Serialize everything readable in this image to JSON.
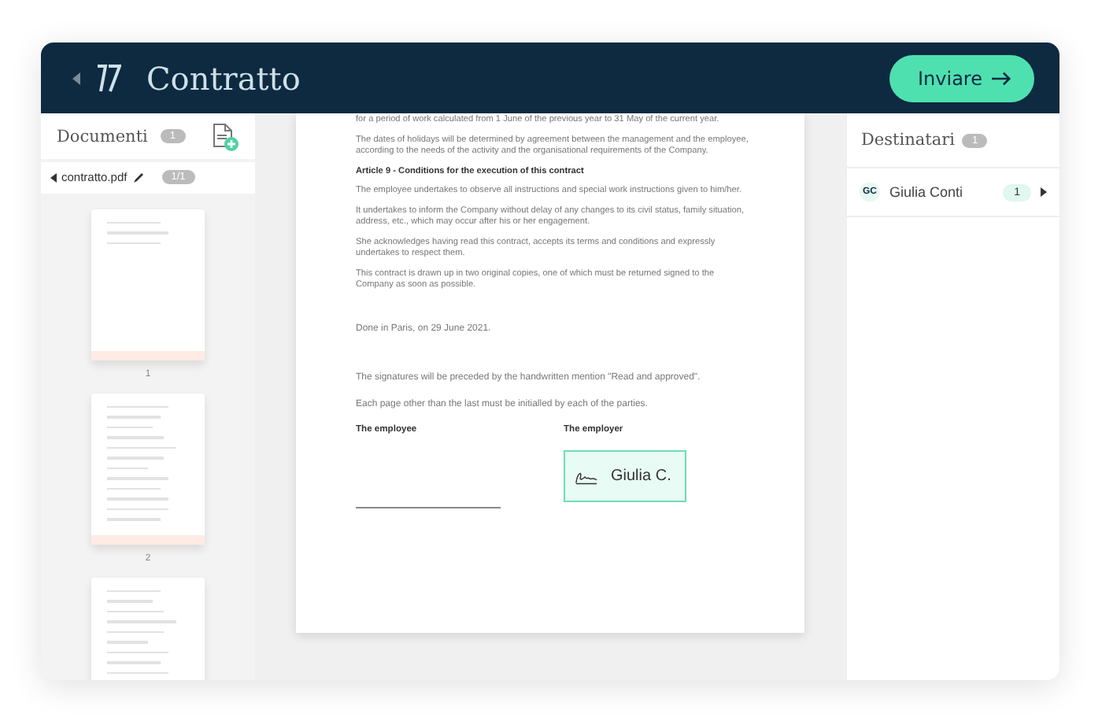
{
  "header": {
    "title": "Contratto",
    "send_button": "Inviare"
  },
  "documents": {
    "title": "Documenti",
    "count": "1",
    "file": {
      "name": "contratto.pdf",
      "pages": "1/1"
    },
    "thumbnails": [
      {
        "label": "1",
        "kind": "cover"
      },
      {
        "label": "2",
        "kind": "text"
      },
      {
        "kind": "text"
      }
    ]
  },
  "document": {
    "blocks": [
      {
        "kind": "p",
        "text": "for a period of work calculated from 1 June of the previous year to 31 May of the current year."
      },
      {
        "kind": "p",
        "text": "The dates of holidays will be determined by agreement between the management and the employee, according to the needs of the activity and the organisational requirements of the Company."
      },
      {
        "kind": "h",
        "text": "Article 9 - Conditions for the execution of this contract"
      },
      {
        "kind": "p",
        "text": "The employee undertakes to observe all instructions and special work instructions given to him/her."
      },
      {
        "kind": "p",
        "text": "It undertakes to inform the Company without delay of any changes to its civil status, family situation, address, etc., which may occur after his or her engagement."
      },
      {
        "kind": "p",
        "text": "She acknowledges having read this contract, accepts its terms and conditions and expressly undertakes to respect them."
      },
      {
        "kind": "p",
        "text": "This contract is drawn up in two original copies, one of which must be returned signed to the Company as soon as possible."
      },
      {
        "kind": "gap"
      },
      {
        "kind": "p2",
        "text": "Done in Paris, on 29 June 2021."
      },
      {
        "kind": "gap"
      },
      {
        "kind": "p2",
        "text": "The signatures will be preceded by the handwritten mention \"Read and approved\"."
      },
      {
        "kind": "p2",
        "text": "Each page other than the last must be initialled by each of the parties."
      }
    ],
    "signatures": [
      {
        "label": "The employee",
        "signed": false
      },
      {
        "label": "The employer",
        "signed": true,
        "signer": "Giulia C."
      }
    ]
  },
  "recipients": {
    "title": "Destinatari",
    "count": "1",
    "items": [
      {
        "initials": "GC",
        "name": "Giulia Conti",
        "count": "1"
      }
    ]
  }
}
